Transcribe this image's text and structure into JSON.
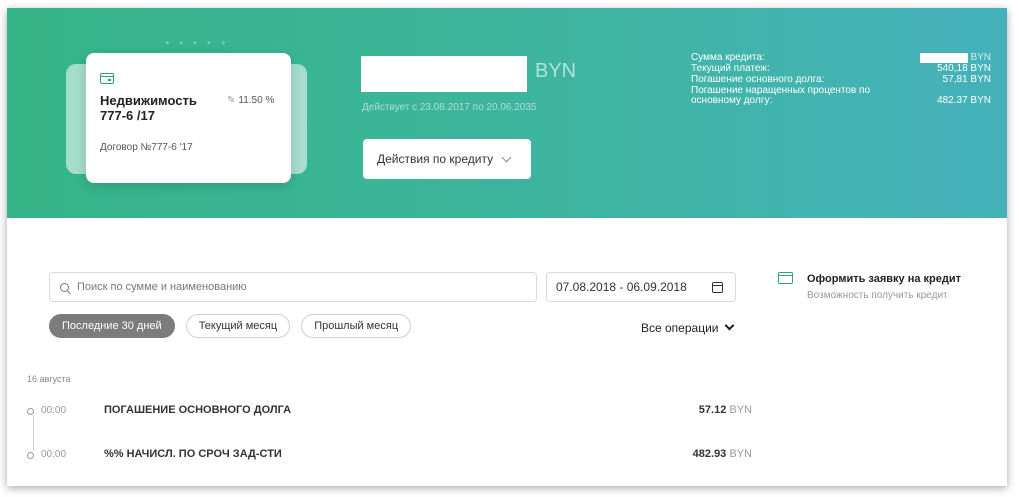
{
  "loan": {
    "name": "Недвижимость 777-6      /17",
    "rate": "11.50 %",
    "contract": "Договор №777-6      '17",
    "amount_currency": "BYN",
    "validity": "Действует с 23.08.2017 по 20.06.2035",
    "actions_label": "Действия по кредиту"
  },
  "summary": {
    "rows": [
      {
        "label": "Сумма кредита:",
        "value": "BYN"
      },
      {
        "label": "Текущий платеж:",
        "value": "540,18 BYN"
      },
      {
        "label": "Погашение основного долга:",
        "value": "57,81 BYN"
      },
      {
        "label": "Погашение наращенных процентов по основному долгу:",
        "value": "482.37 BYN"
      }
    ]
  },
  "filters": {
    "search_placeholder": "Поиск по сумме и наименованию",
    "date_range": "07.08.2018 - 06.09.2018",
    "periods": [
      "Последние 30 дней",
      "Текущий месяц",
      "Прошлый месяц"
    ],
    "operations_label": "Все операции"
  },
  "credit_offer": {
    "title": "Оформить заявку на кредит",
    "subtitle": "Возможность получить кредит"
  },
  "history": {
    "day": "16 августа",
    "transactions": [
      {
        "time": "00:00",
        "name": "ПОГАШЕНИЕ ОСНОВНОГО ДОЛГА",
        "amount": "57.12",
        "currency": "BYN"
      },
      {
        "time": "00:00",
        "name": "%% НАЧИСЛ. ПО СРОЧ ЗАД-СТИ",
        "amount": "482.93",
        "currency": "BYN"
      }
    ]
  },
  "colors": {
    "banner_start": "#35b487",
    "banner_end": "#45b2bb",
    "accent_green": "#2ca46f",
    "active_pill": "#7c7c7c"
  }
}
